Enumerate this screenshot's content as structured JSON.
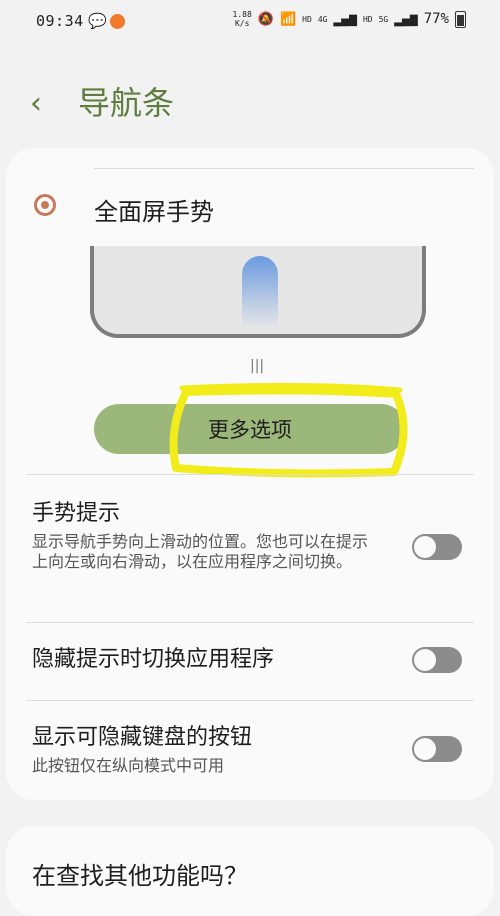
{
  "status_bar": {
    "time": "09:34",
    "speed_value": "1.88",
    "speed_unit": "K/s",
    "wifi_label": "HD",
    "net1": "4G",
    "net2": "HD",
    "net3": "5G",
    "battery": "77%"
  },
  "header": {
    "back_icon": "chevron-left-icon",
    "title": "导航条"
  },
  "gesture_option": {
    "label": "全面屏手势",
    "selected": true,
    "handle": "|||"
  },
  "more_button": {
    "label": "更多选项"
  },
  "settings": [
    {
      "name": "手势提示",
      "description": "显示导航手势向上滑动的位置。您也可以在提示上向左或向右滑动，以在应用程序之间切换。",
      "enabled": false
    },
    {
      "name": "隐藏提示时切换应用程序",
      "description": "",
      "enabled": false
    },
    {
      "name": "显示可隐藏键盘的按钮",
      "description": "此按钮仅在纵向模式中可用",
      "enabled": false
    }
  ],
  "footer": {
    "question": "在查找其他功能吗？"
  },
  "colors": {
    "accent": "#5f7d3e",
    "button": "#9cb77a",
    "radio": "#c47a5c",
    "highlight": "#f2ec1a"
  }
}
